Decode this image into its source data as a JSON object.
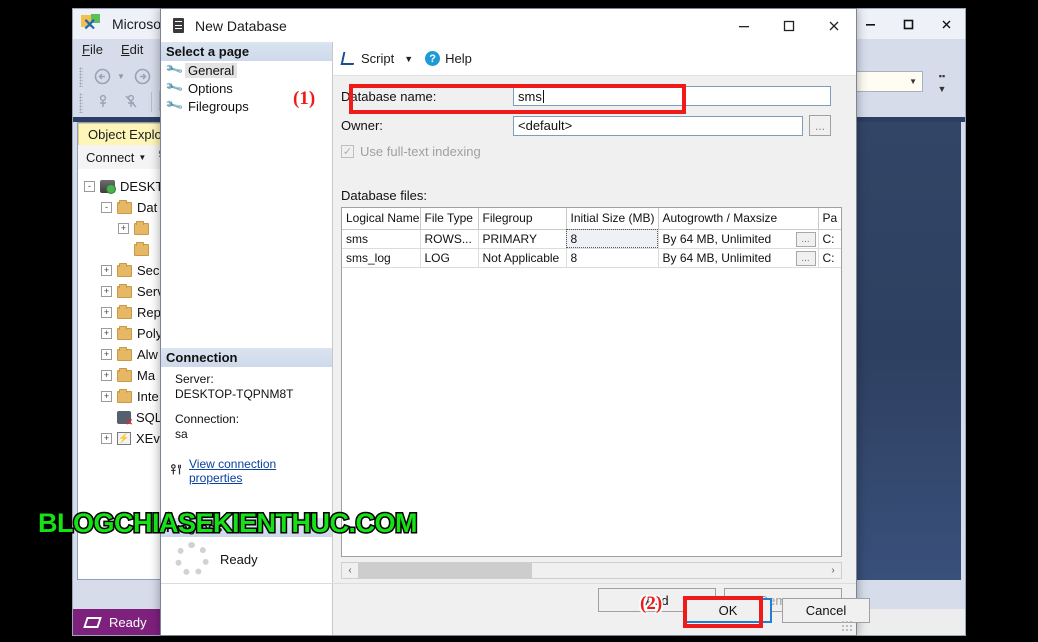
{
  "background_window": {
    "title": "Microsoft",
    "icon": "ssms-icon",
    "menus": [
      "File",
      "Edit"
    ],
    "window_controls": {
      "minimize": "–",
      "maximize": "□",
      "close": "✕"
    },
    "object_explorer": {
      "tab_label": "Object Explore",
      "connect_label": "Connect",
      "tree": [
        {
          "label": "DESKTO",
          "expander": "-",
          "icon": "server-icon",
          "indent": 0
        },
        {
          "label": "Dat",
          "expander": "-",
          "icon": "folder-icon",
          "indent": 1
        },
        {
          "label": "",
          "expander": "+",
          "icon": "folder-icon",
          "indent": 2
        },
        {
          "label": "",
          "expander": "",
          "icon": "folder-icon",
          "indent": 2
        },
        {
          "label": "Sec",
          "expander": "+",
          "icon": "folder-icon",
          "indent": 1
        },
        {
          "label": "Serv",
          "expander": "+",
          "icon": "folder-icon",
          "indent": 1
        },
        {
          "label": "Rep",
          "expander": "+",
          "icon": "folder-icon",
          "indent": 1
        },
        {
          "label": "Poly",
          "expander": "+",
          "icon": "folder-icon",
          "indent": 1
        },
        {
          "label": "Alw",
          "expander": "+",
          "icon": "folder-icon",
          "indent": 1
        },
        {
          "label": "Ma",
          "expander": "+",
          "icon": "folder-icon",
          "indent": 1
        },
        {
          "label": "Inte",
          "expander": "+",
          "icon": "folder-icon",
          "indent": 1
        },
        {
          "label": "SQL",
          "expander": "",
          "icon": "sql-agent-icon",
          "indent": 1
        },
        {
          "label": "XEv",
          "expander": "+",
          "icon": "xevent-icon",
          "indent": 1
        }
      ]
    },
    "status_bar": {
      "text": "Ready"
    }
  },
  "dialog": {
    "title": "New Database",
    "icon": "database-server-icon",
    "window_controls": {
      "minimize": "–",
      "maximize": "□",
      "close": "✕"
    },
    "page_panel": {
      "header": "Select a page",
      "items": [
        {
          "label": "General",
          "selected": true
        },
        {
          "label": "Options",
          "selected": false
        },
        {
          "label": "Filegroups",
          "selected": false
        }
      ]
    },
    "connection": {
      "header": "Connection",
      "server_label": "Server:",
      "server_value": "DESKTOP-TQPNM8T",
      "connection_label": "Connection:",
      "connection_value": "sa",
      "view_properties_link": "View connection properties"
    },
    "progress": {
      "header": "Progress",
      "status": "Ready"
    },
    "toolbar": {
      "script_label": "Script",
      "script_caret": "▼",
      "help_label": "Help",
      "help_glyph": "?"
    },
    "form": {
      "database_name_label": "Database name:",
      "database_name_value": "sms",
      "owner_label": "Owner:",
      "owner_value": "<default>",
      "owner_browse_label": "...",
      "fulltext_label": "Use full-text indexing",
      "fulltext_checked": true,
      "fulltext_enabled": false,
      "database_files_label": "Database files:"
    },
    "files_grid": {
      "columns": [
        "Logical Name",
        "File Type",
        "Filegroup",
        "Initial Size (MB)",
        "Autogrowth / Maxsize",
        "Pa"
      ],
      "rows": [
        {
          "logical_name": "sms",
          "file_type": "ROWS...",
          "filegroup": "PRIMARY",
          "initial_size": "8",
          "autogrowth": "By 64 MB, Unlimited",
          "autogrowth_button": "...",
          "path": "C:"
        },
        {
          "logical_name": "sms_log",
          "file_type": "LOG",
          "filegroup": "Not Applicable",
          "initial_size": "8",
          "autogrowth": "By 64 MB, Unlimited",
          "autogrowth_button": "...",
          "path": "C:"
        }
      ]
    },
    "buttons": {
      "add": "Add",
      "remove": "Remove",
      "ok": "OK",
      "cancel": "Cancel"
    }
  },
  "annotations": {
    "marker_1": "(1)",
    "marker_2": "(2)",
    "color": "#EF1B1B"
  },
  "watermark": {
    "text": "BLOGCHIASEKIENTHUC.COM",
    "color": "#16E016"
  }
}
